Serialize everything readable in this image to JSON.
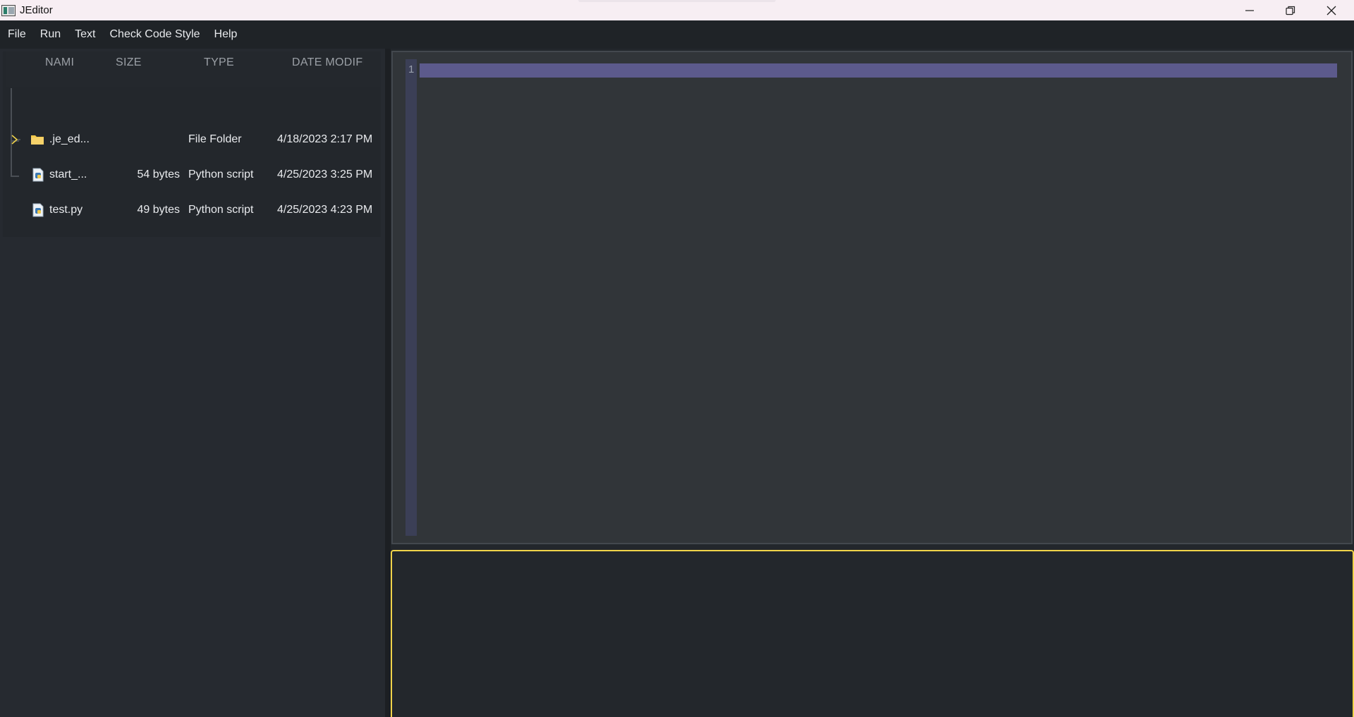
{
  "window": {
    "title": "JEditor",
    "controls": [
      "minimize",
      "restore",
      "close"
    ]
  },
  "menu": {
    "items": [
      "File",
      "Run",
      "Text",
      "Check Code Style",
      "Help"
    ]
  },
  "file_tree": {
    "columns": [
      "NAMI",
      "SIZE",
      "TYPE",
      "DATE MODIFIE"
    ],
    "rows": [
      {
        "name": ".je_ed...",
        "size": "",
        "type": "File Folder",
        "date": "4/18/2023 2:17 PM",
        "icon": "folder-icon"
      },
      {
        "name": "start_...",
        "size": "54 bytes",
        "type": "Python script",
        "date": "4/25/2023 3:25 PM",
        "icon": "python-file-icon"
      },
      {
        "name": "test.py",
        "size": "49 bytes",
        "type": "Python script",
        "date": "4/25/2023 4:23 PM",
        "icon": "python-file-icon"
      }
    ]
  },
  "editor": {
    "line_number": "1",
    "content": ""
  },
  "colors": {
    "accent_border": "#f0d34a",
    "current_line": "#5c5a8c",
    "folder": "#f2c94c"
  }
}
